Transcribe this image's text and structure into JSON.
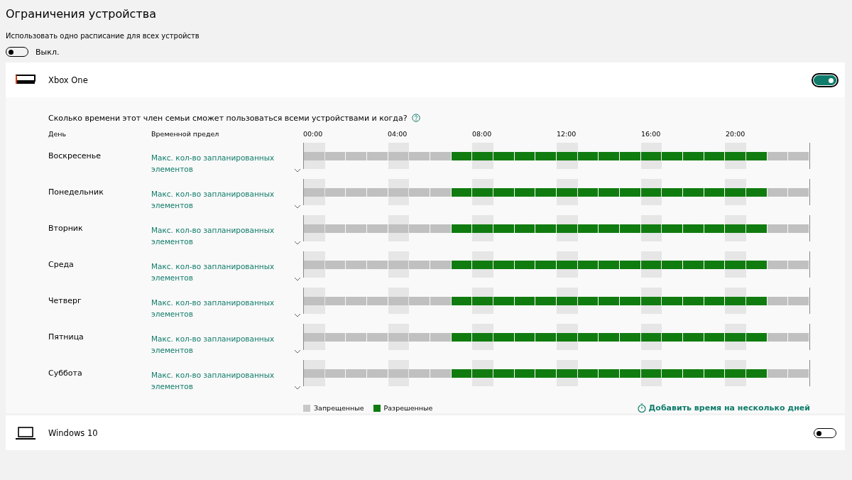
{
  "title": "Ограничения устройства",
  "shared_schedule": {
    "label": "Использовать одно расписание для всех устройств",
    "on": false,
    "state_text": "Выкл."
  },
  "devices": [
    {
      "kind": "console",
      "name": "Xbox One",
      "on": true,
      "expanded": true,
      "question": "Сколько времени этот член семьи сможет пользоваться всеми устройствами и когда?",
      "columns": [
        "День",
        "Временной предел"
      ],
      "hour_labels": [
        "00:00",
        "04:00",
        "08:00",
        "12:00",
        "16:00",
        "20:00"
      ],
      "days": [
        {
          "day": "Воскресенье",
          "limit": "Макс. кол-во запланированных элементов",
          "allowed": [
            false,
            false,
            false,
            false,
            false,
            false,
            false,
            true,
            true,
            true,
            true,
            true,
            true,
            true,
            true,
            true,
            true,
            true,
            true,
            true,
            true,
            true,
            false,
            false
          ]
        },
        {
          "day": "Понедельник",
          "limit": "Макс. кол-во запланированных элементов",
          "allowed": [
            false,
            false,
            false,
            false,
            false,
            false,
            false,
            true,
            true,
            true,
            true,
            true,
            true,
            true,
            true,
            true,
            true,
            true,
            true,
            true,
            true,
            true,
            false,
            false
          ]
        },
        {
          "day": "Вторник",
          "limit": "Макс. кол-во запланированных элементов",
          "allowed": [
            false,
            false,
            false,
            false,
            false,
            false,
            false,
            true,
            true,
            true,
            true,
            true,
            true,
            true,
            true,
            true,
            true,
            true,
            true,
            true,
            true,
            true,
            false,
            false
          ]
        },
        {
          "day": "Среда",
          "limit": "Макс. кол-во запланированных элементов",
          "allowed": [
            false,
            false,
            false,
            false,
            false,
            false,
            false,
            true,
            true,
            true,
            true,
            true,
            true,
            true,
            true,
            true,
            true,
            true,
            true,
            true,
            true,
            true,
            false,
            false
          ]
        },
        {
          "day": "Четверг",
          "limit": "Макс. кол-во запланированных элементов",
          "allowed": [
            false,
            false,
            false,
            false,
            false,
            false,
            false,
            true,
            true,
            true,
            true,
            true,
            true,
            true,
            true,
            true,
            true,
            true,
            true,
            true,
            true,
            true,
            false,
            false
          ]
        },
        {
          "day": "Пятница",
          "limit": "Макс. кол-во запланированных элементов",
          "allowed": [
            false,
            false,
            false,
            false,
            false,
            false,
            false,
            true,
            true,
            true,
            true,
            true,
            true,
            true,
            true,
            true,
            true,
            true,
            true,
            true,
            true,
            true,
            false,
            false
          ]
        },
        {
          "day": "Суббота",
          "limit": "Макс. кол-во запланированных элементов",
          "allowed": [
            false,
            false,
            false,
            false,
            false,
            false,
            false,
            true,
            true,
            true,
            true,
            true,
            true,
            true,
            true,
            true,
            true,
            true,
            true,
            true,
            true,
            true,
            false,
            false
          ]
        }
      ],
      "legend": [
        {
          "label": "Запрещенные",
          "color": "#c8c8c8"
        },
        {
          "label": "Разрешенные",
          "color": "#107c10"
        }
      ],
      "add_time_link": "Добавить время на несколько дней"
    },
    {
      "kind": "laptop",
      "name": "Windows 10",
      "on": false,
      "expanded": false
    }
  ]
}
